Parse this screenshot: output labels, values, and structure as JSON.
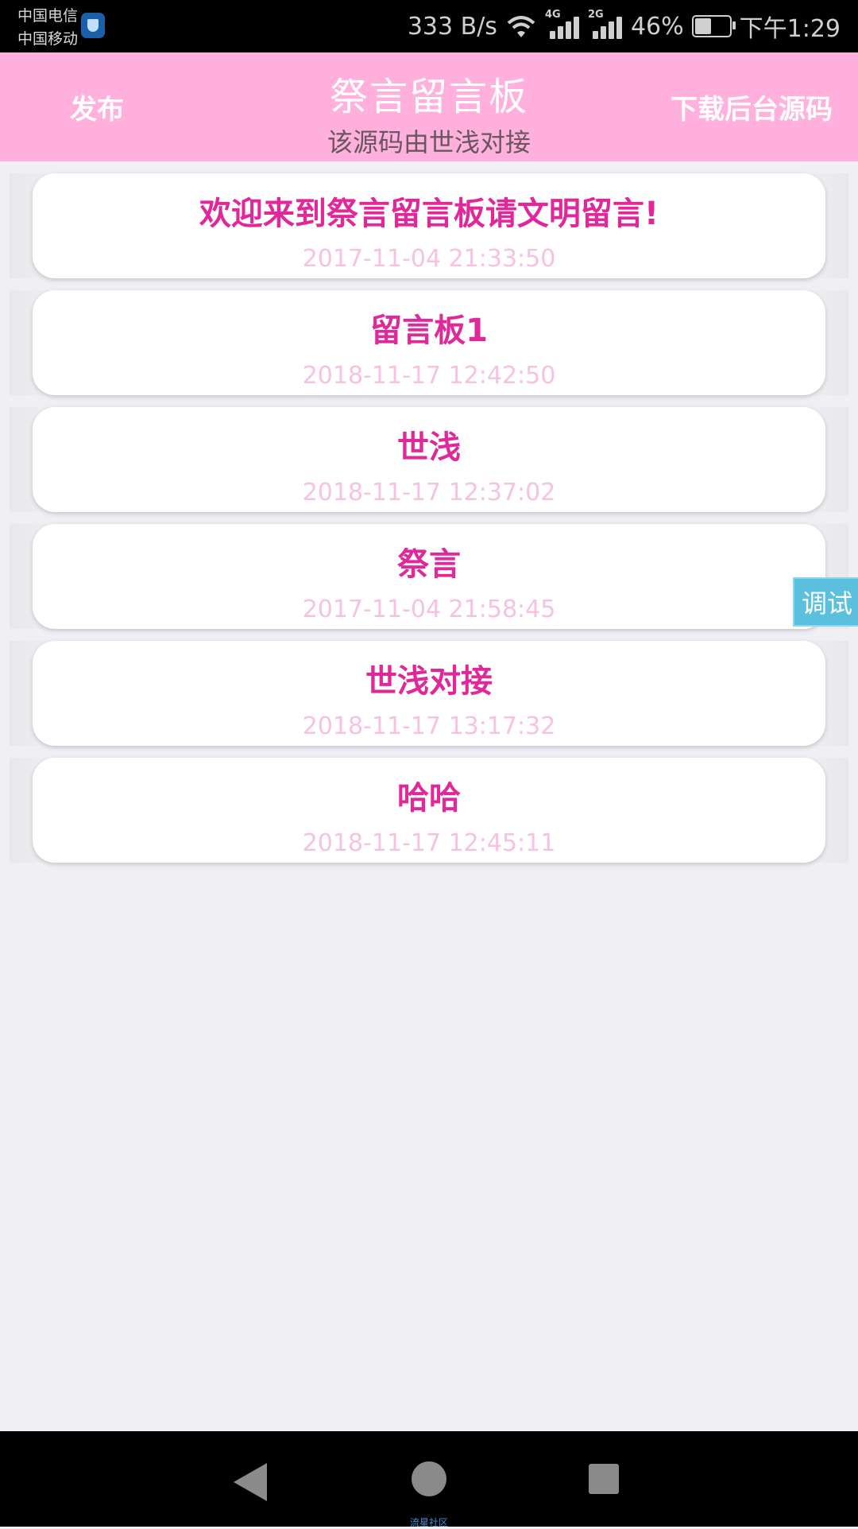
{
  "status_bar": {
    "carrier1": "中国电信",
    "carrier2": "中国移动",
    "net_speed": "333 B/s",
    "net_label1": "4G",
    "net_label2": "2G",
    "battery": "46%",
    "time": "下午1:29"
  },
  "header": {
    "left_button": "发布",
    "title": "祭言留言板",
    "subtitle": "该源码由世浅对接",
    "right_button": "下载后台源码"
  },
  "messages": [
    {
      "title": "欢迎来到祭言留言板请文明留言!",
      "time": "2017-11-04 21:33:50"
    },
    {
      "title": "留言板1",
      "time": "2018-11-17 12:42:50"
    },
    {
      "title": "世浅",
      "time": "2018-11-17 12:37:02"
    },
    {
      "title": "祭言",
      "time": "2017-11-04 21:58:45"
    },
    {
      "title": "世浅对接",
      "time": "2018-11-17 13:17:32"
    },
    {
      "title": "哈哈",
      "time": "2018-11-17 12:45:11"
    }
  ],
  "debug_button": "调试",
  "nav_caption": "流星社区",
  "colors": {
    "header_bg": "#ffb0dc",
    "title_color": "#e0289a",
    "time_color": "#f6c2e2",
    "debug_bg": "#5bc0de"
  }
}
